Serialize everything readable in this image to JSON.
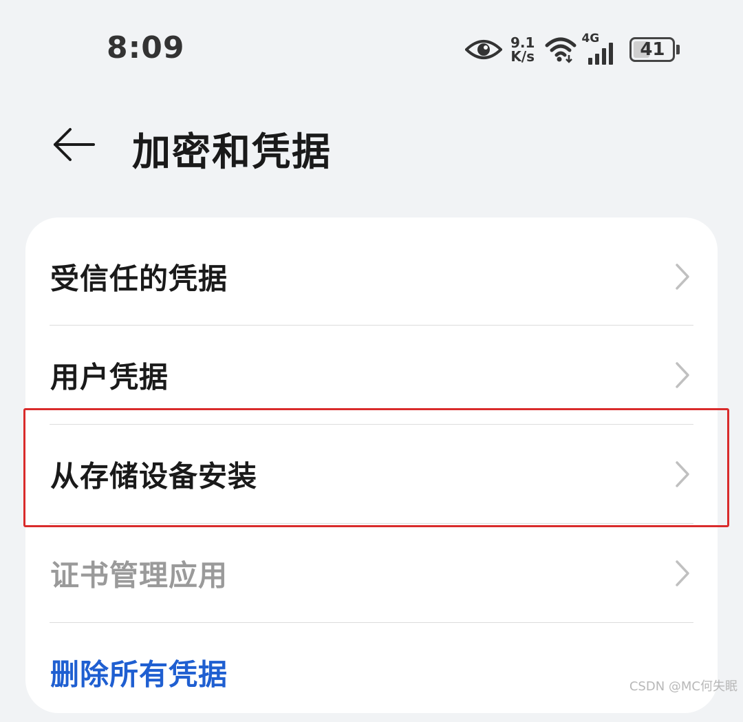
{
  "status_bar": {
    "time": "8:09",
    "net_speed_value": "9.1",
    "net_speed_unit": "K/s",
    "signal_label": "4G",
    "battery_level": "41",
    "battery_fraction": 0.41
  },
  "header": {
    "title": "加密和凭据"
  },
  "menu": {
    "items": [
      {
        "label": "受信任的凭据",
        "state": "normal"
      },
      {
        "label": "用户凭据",
        "state": "normal"
      },
      {
        "label": "从存储设备安装",
        "state": "highlighted"
      },
      {
        "label": "证书管理应用",
        "state": "disabled"
      },
      {
        "label": "删除所有凭据",
        "state": "danger"
      }
    ]
  },
  "watermark": "CSDN @MC何失眠",
  "colors": {
    "background": "#f1f3f5",
    "card": "#ffffff",
    "text_primary": "#1a1a1a",
    "text_disabled": "#9a9a9a",
    "link_blue": "#1f5fd1",
    "highlight_red": "#d92b2b",
    "chevron": "#c0c0c0"
  }
}
